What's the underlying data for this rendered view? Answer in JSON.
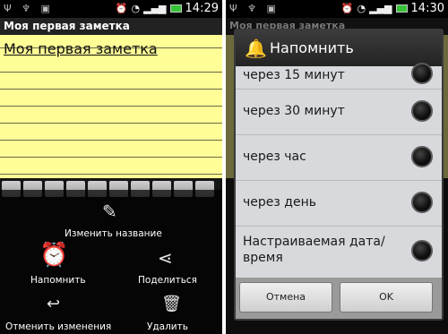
{
  "left": {
    "status_time": "14:29",
    "title": "Моя первая заметка",
    "note_title": "Моя первая заметка",
    "actions": {
      "rename": "Изменить название",
      "remind": "Напомнить",
      "share": "Поделиться",
      "undo": "Отменить изменения",
      "delete": "Удалить"
    }
  },
  "right": {
    "status_time": "14:30",
    "dim_title": "Моя первая заметка",
    "dialog": {
      "title": "Напомнить",
      "options": [
        "через 15 минут",
        "через 30 минут",
        "через час",
        "через день",
        "Настраиваемая дата/",
        "время"
      ],
      "cancel": "Отмена",
      "ok": "OK"
    }
  },
  "icons": {
    "usb": "usb-icon",
    "wifi": "wifi-icon",
    "signal": "signal-icon",
    "battery": "battery-icon",
    "alarm": "alarm-clock-icon",
    "pencil": "pencil-icon",
    "share": "share-icon",
    "undo": "undo-icon",
    "trash": "trash-icon",
    "bell": "bell-icon"
  },
  "colors": {
    "note_yellow": "#fefd96",
    "dialog_bg": "#d7d9dc",
    "battery_green": "#37c337"
  }
}
